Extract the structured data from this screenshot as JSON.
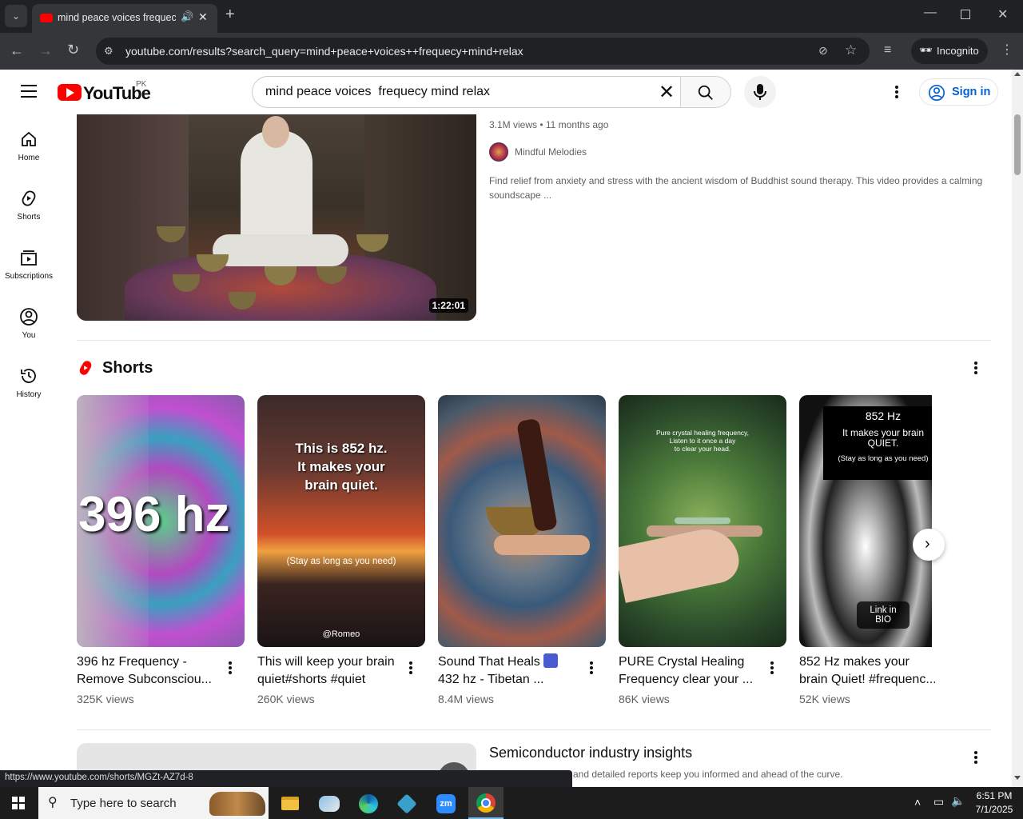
{
  "browser": {
    "tab_title": "mind peace voices frequecy",
    "url": "youtube.com/results?search_query=mind+peace+voices++frequecy+mind+relax",
    "profile_label": "Incognito",
    "status_url": "https://www.youtube.com/shorts/MGZt-AZ7d-8"
  },
  "youtube": {
    "logo_text": "YouTube",
    "region": "PK",
    "search_value": "mind peace voices  frequecy mind relax",
    "sign_in": "Sign in"
  },
  "sidebar": {
    "items": [
      {
        "label": "Home",
        "icon": "home-icon"
      },
      {
        "label": "Shorts",
        "icon": "shorts-icon"
      },
      {
        "label": "Subscriptions",
        "icon": "subscriptions-icon"
      },
      {
        "label": "You",
        "icon": "you-icon"
      },
      {
        "label": "History",
        "icon": "history-icon"
      }
    ]
  },
  "video": {
    "duration": "1:22:01",
    "views_age": "3.1M views • 11 months ago",
    "channel": "Mindful Melodies",
    "description": "Find relief from anxiety and stress with the ancient wisdom of Buddhist sound therapy. This video provides a calming soundscape ..."
  },
  "shorts": {
    "heading": "Shorts",
    "items": [
      {
        "title_l1": "396 hz Frequency -",
        "title_l2": "Remove Subconsciou...",
        "views": "325K views",
        "overlay": [
          "396 hz"
        ]
      },
      {
        "title_l1": "This will keep your brain",
        "title_l2": "quiet#shorts #quiet",
        "views": "260K views",
        "overlay": [
          "This is 852 hz.",
          "It makes your",
          "brain quiet.",
          "(Stay as long as you need)",
          "@Romeo"
        ]
      },
      {
        "title_l1": "Sound That Heals",
        "title_l2": "432 hz - Tibetan ...",
        "views": "8.4M views",
        "overlay": []
      },
      {
        "title_l1": "PURE Crystal Healing",
        "title_l2": "Frequency clear your ...",
        "views": "86K views",
        "overlay": [
          "Pure crystal healing frequency,",
          "Listen to it once a day",
          "to clear your head."
        ]
      },
      {
        "title_l1": "852 Hz makes your",
        "title_l2": "brain Quiet! #frequenc...",
        "views": "52K views",
        "overlay": [
          "852 Hz",
          "It makes your brain",
          "QUIET.",
          "(Stay as long as you need)",
          "Link in",
          "BIO"
        ]
      }
    ]
  },
  "next_result": {
    "title": "Semiconductor industry insights",
    "snippet": "and detailed reports keep you informed and ahead of the curve."
  },
  "taskbar": {
    "search_placeholder": "Type here to search",
    "time": "6:51 PM",
    "date": "7/1/2025"
  },
  "colors": {
    "youtube_red": "#ff0000",
    "link_blue": "#065fd4",
    "chrome_dark": "#202124"
  }
}
